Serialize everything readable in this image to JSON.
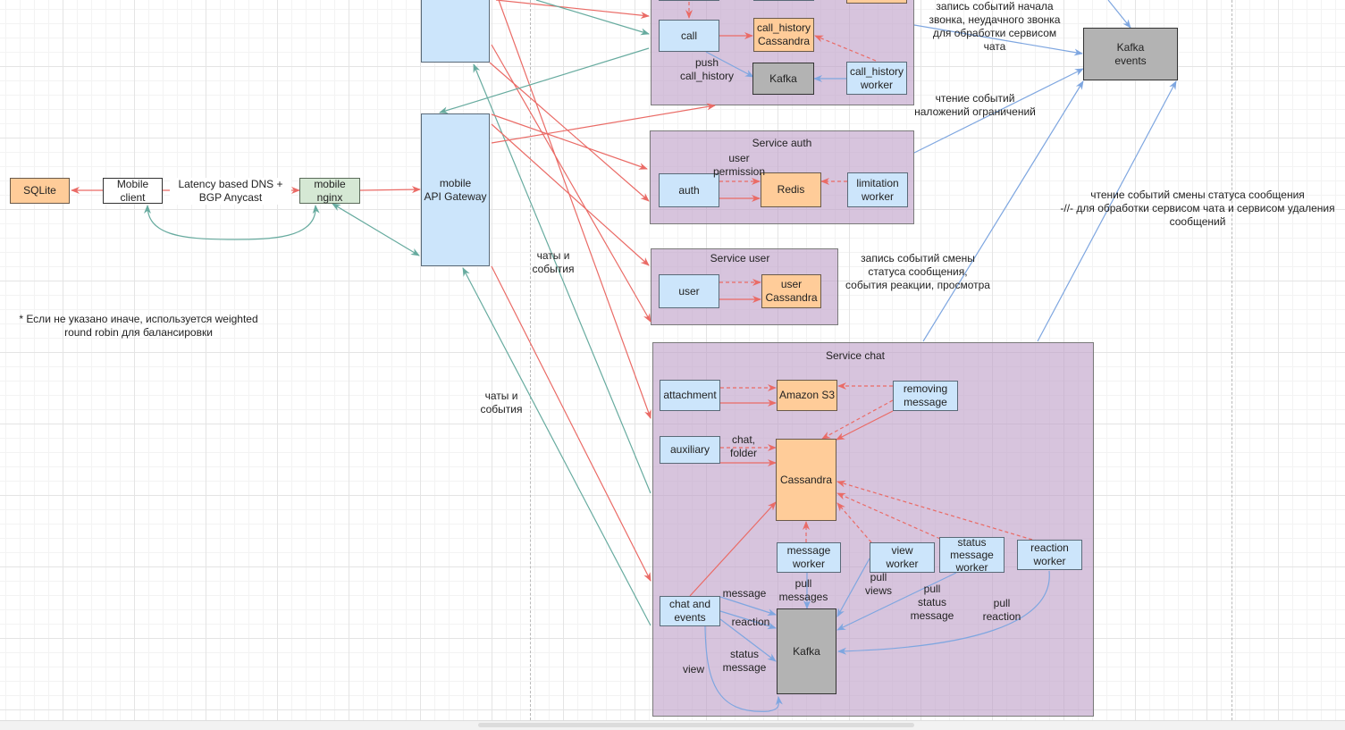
{
  "colors": {
    "request_arrow": "#ea6b66",
    "response_arrow": "#67ab9f",
    "kafka_arrow": "#7ea6e0",
    "service_group": "#d0bcd8",
    "service_node": "#cce5fb",
    "storage_node": "#ffcc99",
    "queue_node": "#b3b3b3",
    "balancer_node": "#d5e8d4"
  },
  "client": {
    "sqlite": "SQLite",
    "mobile_client": "Mobile\nclient",
    "dns_label": "Latency based DNS +\nBGP Anycast",
    "nginx": "mobile\nnginx",
    "note": "* Если не указано иначе, используется weighted\nround robin для балансировки"
  },
  "gateways": {
    "top_gateway": "",
    "mobile_gateway": "mobile\nAPI Gateway",
    "chats_events_label_1": "чаты и\nсобытия",
    "chats_events_label_2": "чаты и\nсобытия"
  },
  "service_call": {
    "call": "call",
    "call_history_cassandra": "call_history\nCassandra",
    "kafka": "Kafka",
    "call_history_worker": "call_history\nworker",
    "push_label": "push\ncall_history"
  },
  "service_auth": {
    "title": "Service auth",
    "auth": "auth",
    "redis": "Redis",
    "limitation_worker": "limitation\nworker",
    "permission_label": "user\npermission"
  },
  "service_user": {
    "title": "Service user",
    "user": "user",
    "user_cassandra": "user\nCassandra"
  },
  "service_chat": {
    "title": "Service chat",
    "attachment": "attachment",
    "amazon_s3": "Amazon S3",
    "removing_message": "removing\nmessage",
    "auxiliary": "auxiliary",
    "chat_folder_label": "chat,\nfolder",
    "cassandra": "Cassandra",
    "message_worker": "message\nworker",
    "view_worker": "view\nworker",
    "status_message_worker": "status\nmessage\nworker",
    "reaction_worker": "reaction\nworker",
    "chat_and_events": "chat and\nevents",
    "kafka": "Kafka",
    "labels": {
      "message": "message",
      "reaction": "reaction",
      "status_message": "status\nmessage",
      "view": "view",
      "pull_messages": "pull\nmessages",
      "pull_views": "pull\nviews",
      "pull_status_message": "pull\nstatus\nmessage",
      "pull_reaction": "pull\nreaction"
    }
  },
  "kafka_events": {
    "node": "Kafka\nevents",
    "label_call_events": "запись событий начала\nзвонка, неудачного звонка\nдля обработки сервисом\nчата",
    "label_limitations": "чтение событий\nналожений ограничений",
    "label_status_read": "чтение событий смены статуса  сообщения\n-//- для обработки сервисом чата и сервисом удаления\nсообщений",
    "label_status_write": "запись событий смены\nстатуса сообщения,\nсобытия реакции, просмотра"
  }
}
